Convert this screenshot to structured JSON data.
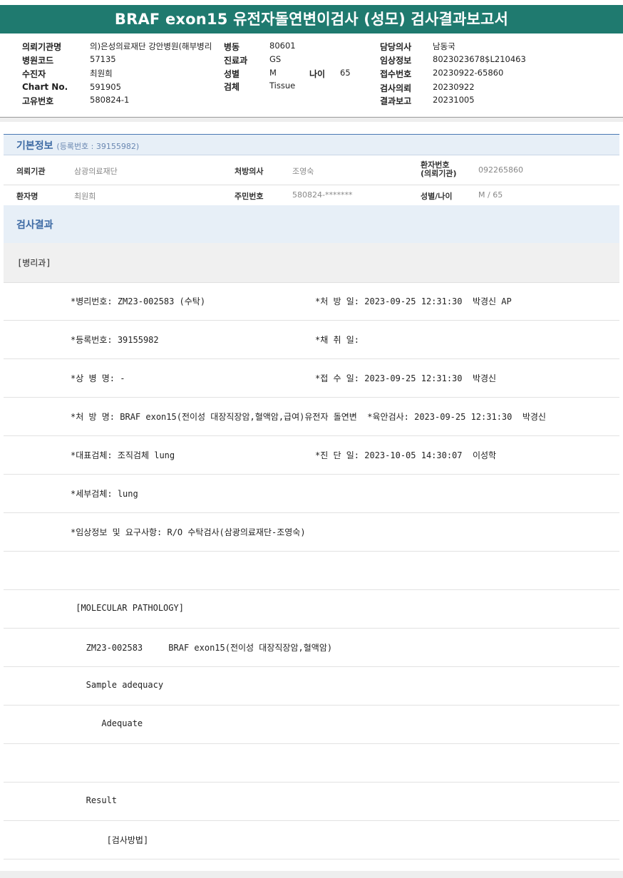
{
  "title": "BRAF exon15 유전자돌연변이검사 (성모) 검사결과보고서",
  "header": {
    "requesting_inst_label": "의뢰기관명",
    "requesting_inst_value": "의)은성의료재단 강안병원(해부병리",
    "ward_label": "병동",
    "ward_value": "80601",
    "doctor_label": "담당의사",
    "doctor_value": "남동국",
    "hospital_code_label": "병원코드",
    "hospital_code_value": "57135",
    "dept_label": "진료과",
    "dept_value": "GS",
    "clinical_label": "임상정보",
    "clinical_value": "8023023678$L210463",
    "examinee_label": "수진자",
    "examinee_value": "최원희",
    "sex_label": "성별",
    "sex_value": "M",
    "age_label": "나이",
    "age_value": "65",
    "receipt_label": "접수번호",
    "receipt_value": "20230922-65860",
    "chart_label": "Chart No.",
    "chart_value": "591905",
    "specimen_label": "검체",
    "specimen_value": "Tissue",
    "request_date_label": "검사의뢰",
    "request_date_value": "20230922",
    "unique_label": "고유번호",
    "unique_value": "580824-1",
    "report_date_label": "결과보고",
    "report_date_value": "20231005"
  },
  "basic_info": {
    "title": "기본정보",
    "reg_no": "(등록번호 : 39155982)",
    "inst_label": "의뢰기관",
    "inst_value": "삼광의료재단",
    "prescriber_label": "처방의사",
    "prescriber_value": "조영숙",
    "patient_no_label_1": "환자번호",
    "patient_no_label_2": "(의뢰기관)",
    "patient_no_value": "092265860",
    "patient_name_label": "환자명",
    "patient_name_value": "최원희",
    "resident_no_label": "주민번호",
    "resident_no_value": "580824-*******",
    "sex_age_label": "성별/나이",
    "sex_age_value": "M / 65"
  },
  "results": {
    "title": "검사결과",
    "dept": "[병리과]",
    "lines": [
      {
        "left": "*병리번호: ZM23-002583 (수탁)",
        "right": "*처 방 일: 2023-09-25 12:31:30  박경신 AP"
      },
      {
        "left": "*등록번호: 39155982",
        "right": "*채 취 일:"
      },
      {
        "left": "*상 병 명: -",
        "right": "*접 수 일: 2023-09-25 12:31:30  박경신"
      },
      {
        "left": "*처 방 명: BRAF exon15(전이성 대장직장암,혈액암,급여)유전자 돌연변  *육안검사: 2023-09-25 12:31:30  박경신",
        "right": ""
      },
      {
        "left": "*대표검체: 조직검체 lung",
        "right": "*진 단 일: 2023-10-05 14:30:07  이성학"
      },
      {
        "left": "*세부검체: lung",
        "right": ""
      },
      {
        "left": "*임상정보 및 요구사항: R/O 수탁검사(삼광의료재단-조영숙)",
        "right": ""
      },
      {
        "left": "",
        "right": ""
      },
      {
        "left": " [MOLECULAR PATHOLOGY]",
        "right": ""
      },
      {
        "left": "   ZM23-002583     BRAF exon15(전이성 대장직장암,혈액암)",
        "right": ""
      },
      {
        "left": "   Sample adequacy",
        "right": ""
      },
      {
        "left": "      Adequate",
        "right": ""
      },
      {
        "left": "",
        "right": ""
      },
      {
        "left": "   Result",
        "right": ""
      },
      {
        "left": "       [검사방법]",
        "right": ""
      }
    ]
  }
}
